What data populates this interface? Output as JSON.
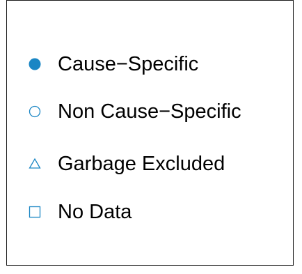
{
  "legend": {
    "items": [
      {
        "label": "Cause−Specific",
        "marker": "filled-circle",
        "color": "#1a86c4"
      },
      {
        "label": "Non Cause−Specific",
        "marker": "open-circle",
        "color": "#1a86c4"
      },
      {
        "label": "Garbage Excluded",
        "marker": "open-triangle",
        "color": "#1a86c4"
      },
      {
        "label": "No Data",
        "marker": "open-square",
        "color": "#1a86c4"
      }
    ]
  }
}
